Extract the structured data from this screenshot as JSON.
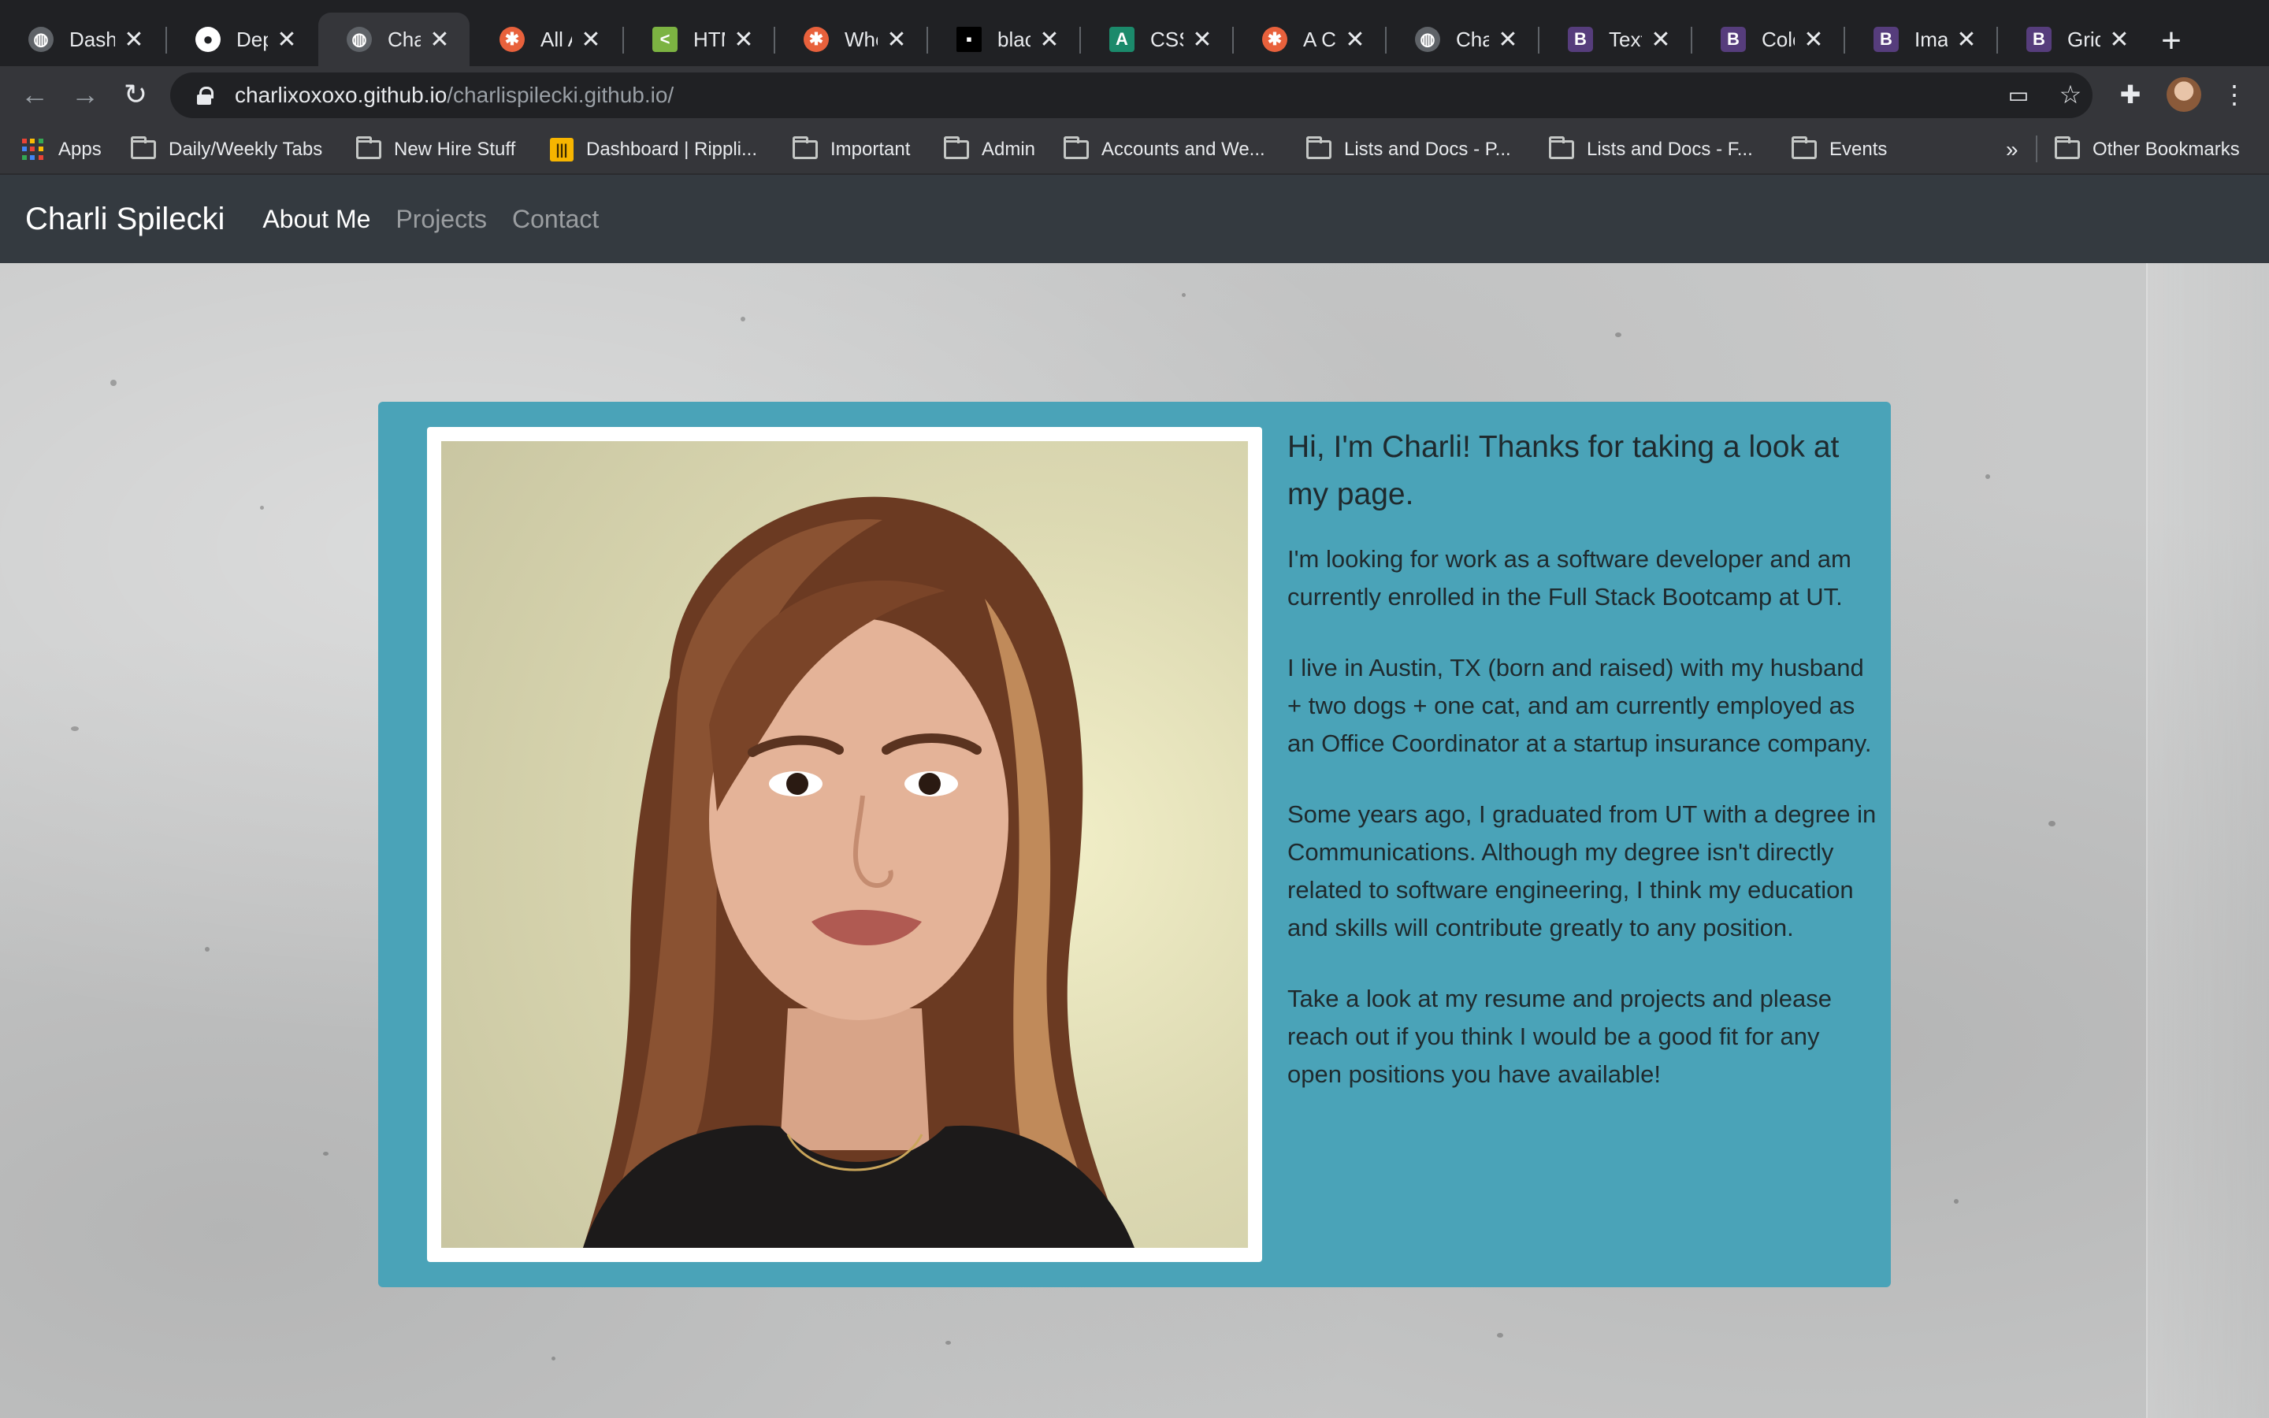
{
  "browser": {
    "tabs": [
      {
        "title": "Dashb",
        "favicon": "globe-icon"
      },
      {
        "title": "Deplo",
        "favicon": "github-icon"
      },
      {
        "title": "Charli",
        "favicon": "globe-icon",
        "active": true
      },
      {
        "title": "All Ab",
        "favicon": "codepen-icon"
      },
      {
        "title": "HTML",
        "favicon": "html-icon"
      },
      {
        "title": "Wher",
        "favicon": "codepen-icon"
      },
      {
        "title": "black",
        "favicon": "black-square-icon"
      },
      {
        "title": "CSS l",
        "favicon": "css-icon"
      },
      {
        "title": "A Cor",
        "favicon": "codepen-icon"
      },
      {
        "title": "Charli",
        "favicon": "globe-icon"
      },
      {
        "title": "Text -",
        "favicon": "bootstrap-icon"
      },
      {
        "title": "Color",
        "favicon": "bootstrap-icon"
      },
      {
        "title": "Image",
        "favicon": "bootstrap-icon"
      },
      {
        "title": "Grid s",
        "favicon": "bootstrap-icon"
      }
    ],
    "close_glyph": "✕",
    "new_tab_glyph": "+",
    "url_host": "charlixoxoxo.github.io",
    "url_path": "/charlispilecki.github.io/",
    "bookmarks": [
      "Apps",
      "Daily/Weekly Tabs",
      "New Hire Stuff",
      "Dashboard | Rippli...",
      "Important",
      "Admin",
      "Accounts and We...",
      "Lists and Docs - P...",
      "Lists and Docs - F...",
      "Events"
    ],
    "bookmarks_overflow": "»",
    "other_bookmarks": "Other Bookmarks"
  },
  "site": {
    "brand": "Charli Spilecki",
    "nav": [
      {
        "label": "About Me",
        "active": true
      },
      {
        "label": "Projects",
        "active": false
      },
      {
        "label": "Contact",
        "active": false
      }
    ],
    "lead": "Hi, I'm Charli! Thanks for taking a look at my page.",
    "paragraphs": [
      "I'm looking for work as a software developer and am currently enrolled in the Full Stack Bootcamp at UT.",
      "I live in Austin, TX (born and raised) with my husband + two dogs + one cat, and am currently employed as an Office Coordinator at a startup insurance company.",
      "Some years ago, I graduated from UT with a degree in Communications. Although my degree isn't directly related to software engineering, I think my education and skills will contribute greatly to any position.",
      "Take a look at my resume and projects and please reach out if you think I would be a good fit for any open positions you have available!"
    ],
    "colors": {
      "navbar": "#343a40",
      "card": "#4aa3b8",
      "background": "#c8c9c9"
    }
  }
}
